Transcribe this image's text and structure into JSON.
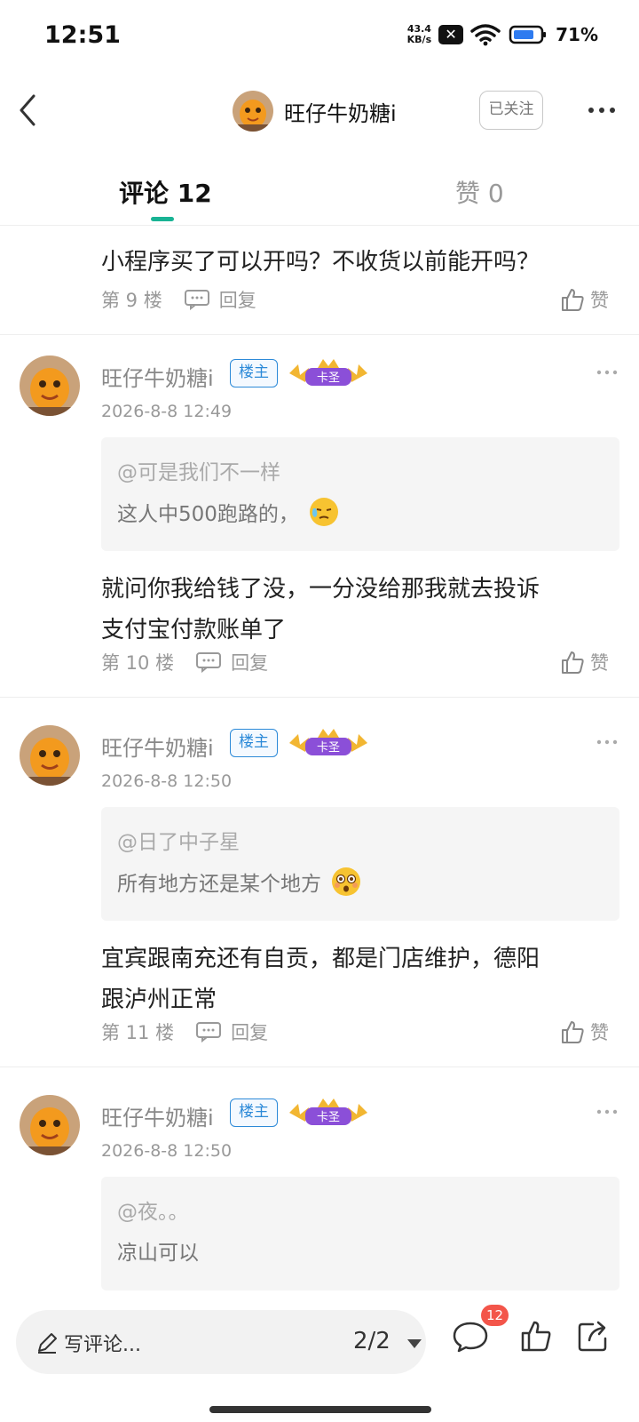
{
  "status_bar": {
    "time": "12:51",
    "net_speed_value": "43.4",
    "net_speed_unit": "KB/s",
    "battery": "71%",
    "icons": [
      "sim-off-icon",
      "wifi-icon",
      "battery-icon"
    ]
  },
  "header": {
    "back_icon": "chevron-left-icon",
    "author_name": "旺仔牛奶糖i",
    "follow_label": "已关注",
    "more_icon": "more-horizontal-icon"
  },
  "tabs": {
    "comments_label": "评论 12",
    "likes_label": "赞 0",
    "active": "comments",
    "accent_color": "#19b394"
  },
  "first_item": {
    "text": "小程序买了可以开吗？不收货以前能开吗？",
    "floor": "第 9 楼",
    "reply_label": "回复",
    "like_label": "赞"
  },
  "comments": [
    {
      "name": "旺仔牛奶糖i",
      "owner_badge": "楼主",
      "crown_badge": "卡圣",
      "time": "2026-8-8 12:49",
      "quote_user": "@可是我们不一样",
      "quote_text": "这人中500跑路的，",
      "quote_emoji": "sweat-face-emoji",
      "body_line1": "就问你我给钱了没，一分没给那我就去投诉",
      "body_line2": "支付宝付款账单了",
      "floor": "第 10 楼",
      "reply_label": "回复",
      "like_label": "赞"
    },
    {
      "name": "旺仔牛奶糖i",
      "owner_badge": "楼主",
      "crown_badge": "卡圣",
      "time": "2026-8-8 12:50",
      "quote_user": "@日了中子星",
      "quote_text": "所有地方还是某个地方",
      "quote_emoji": "astonished-face-emoji",
      "body_line1": "宜宾跟南充还有自贡，都是门店维护，德阳",
      "body_line2": "跟泸州正常",
      "floor": "第 11 楼",
      "reply_label": "回复",
      "like_label": "赞"
    },
    {
      "name": "旺仔牛奶糖i",
      "owner_badge": "楼主",
      "crown_badge": "卡圣",
      "time": "2026-8-8 12:50",
      "quote_user": "@夜。。",
      "quote_text": "凉山可以"
    }
  ],
  "bottom_bar": {
    "write_placeholder": "写评论...",
    "page_indicator": "2/2",
    "comment_count_badge": "12",
    "badge_color": "#f3554a",
    "icons": [
      "pen-icon",
      "caret-down-icon",
      "comment-bubble-icon",
      "thumbs-up-icon",
      "share-icon"
    ]
  }
}
